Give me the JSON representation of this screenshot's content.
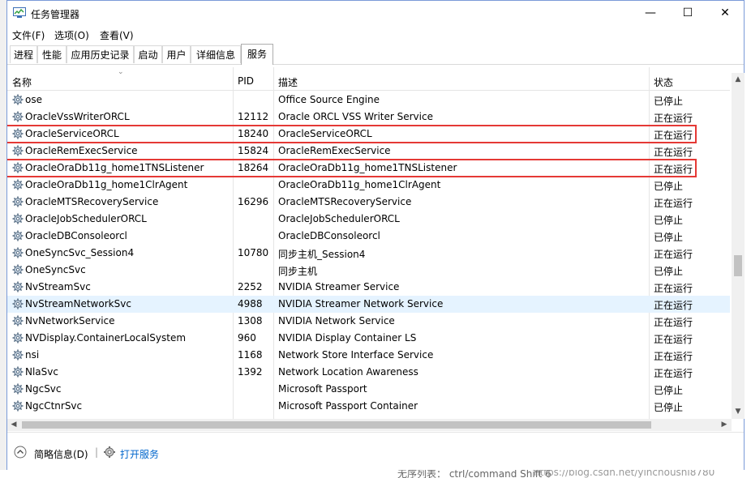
{
  "window": {
    "title": "任务管理器",
    "minimize": "—",
    "maximize": "☐",
    "close": "✕"
  },
  "menu": [
    {
      "label": "文件(F)"
    },
    {
      "label": "选项(O)"
    },
    {
      "label": "查看(V)"
    }
  ],
  "tabs": [
    {
      "label": "进程"
    },
    {
      "label": "性能"
    },
    {
      "label": "应用历史记录"
    },
    {
      "label": "启动"
    },
    {
      "label": "用户"
    },
    {
      "label": "详细信息"
    },
    {
      "label": "服务",
      "active": true
    }
  ],
  "columns": {
    "name": "名称",
    "pid": "PID",
    "desc": "描述",
    "status": "状态"
  },
  "rows": [
    {
      "name": "ose",
      "pid": "",
      "desc": "Office Source Engine",
      "status": "已停止"
    },
    {
      "name": "OracleVssWriterORCL",
      "pid": "12112",
      "desc": "Oracle ORCL VSS Writer Service",
      "status": "正在运行"
    },
    {
      "name": "OracleServiceORCL",
      "pid": "18240",
      "desc": "OracleServiceORCL",
      "status": "正在运行",
      "highlight": true
    },
    {
      "name": "OracleRemExecService",
      "pid": "15824",
      "desc": "OracleRemExecService",
      "status": "正在运行"
    },
    {
      "name": "OracleOraDb11g_home1TNSListener",
      "pid": "18264",
      "desc": "OracleOraDb11g_home1TNSListener",
      "status": "正在运行",
      "highlight": true
    },
    {
      "name": "OracleOraDb11g_home1ClrAgent",
      "pid": "",
      "desc": "OracleOraDb11g_home1ClrAgent",
      "status": "已停止"
    },
    {
      "name": "OracleMTSRecoveryService",
      "pid": "16296",
      "desc": "OracleMTSRecoveryService",
      "status": "正在运行"
    },
    {
      "name": "OracleJobSchedulerORCL",
      "pid": "",
      "desc": "OracleJobSchedulerORCL",
      "status": "已停止"
    },
    {
      "name": "OracleDBConsoleorcl",
      "pid": "",
      "desc": "OracleDBConsoleorcl",
      "status": "已停止"
    },
    {
      "name": "OneSyncSvc_Session4",
      "pid": "10780",
      "desc": "同步主机_Session4",
      "status": "正在运行"
    },
    {
      "name": "OneSyncSvc",
      "pid": "",
      "desc": "同步主机",
      "status": "已停止"
    },
    {
      "name": "NvStreamSvc",
      "pid": "2252",
      "desc": "NVIDIA Streamer Service",
      "status": "正在运行"
    },
    {
      "name": "NvStreamNetworkSvc",
      "pid": "4988",
      "desc": "NVIDIA Streamer Network Service",
      "status": "正在运行",
      "selected": true
    },
    {
      "name": "NvNetworkService",
      "pid": "1308",
      "desc": "NVIDIA Network Service",
      "status": "正在运行"
    },
    {
      "name": "NVDisplay.ContainerLocalSystem",
      "pid": "960",
      "desc": "NVIDIA Display Container LS",
      "status": "正在运行"
    },
    {
      "name": "nsi",
      "pid": "1168",
      "desc": "Network Store Interface Service",
      "status": "正在运行"
    },
    {
      "name": "NlaSvc",
      "pid": "1392",
      "desc": "Network Location Awareness",
      "status": "正在运行"
    },
    {
      "name": "NgcSvc",
      "pid": "",
      "desc": "Microsoft Passport",
      "status": "已停止"
    },
    {
      "name": "NgcCtnrSvc",
      "pid": "",
      "desc": "Microsoft Passport Container",
      "status": "已停止"
    }
  ],
  "footer": {
    "fewer_details": "简略信息(D)",
    "separator": "|",
    "open_services": "打开服务"
  },
  "background": {
    "bottom_text": "无序列表：  ctrl/command  Shift  6",
    "watermark": "https://blog.csdn.net/yinchoushi8780"
  },
  "colors": {
    "highlight_box": "#e53935",
    "selected_row": "#e5f3ff",
    "link": "#0066cc"
  },
  "icons": {
    "app": "task-manager-icon",
    "service": "gear-icon",
    "fewer": "chevron-up-icon",
    "open": "services-icon"
  }
}
